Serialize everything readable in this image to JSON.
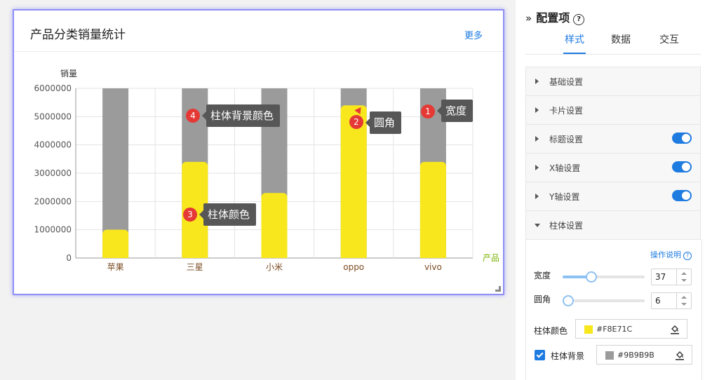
{
  "card": {
    "title": "产品分类销量统计",
    "more": "更多"
  },
  "chart_data": {
    "type": "bar",
    "ylabel": "销量",
    "xlabel": "产品",
    "categories": [
      "苹果",
      "三星",
      "小米",
      "oppo",
      "vivo"
    ],
    "values": [
      1000000,
      3400000,
      2300000,
      5400000,
      3400000
    ],
    "background_value": 6000000,
    "ylim": [
      0,
      6000000
    ],
    "yticks": [
      "0",
      "1000000",
      "2000000",
      "3000000",
      "4000000",
      "5000000",
      "6000000"
    ],
    "bar_color": "#F8E71C",
    "bar_background_color": "#9B9B9B",
    "grid": true
  },
  "callouts": [
    {
      "num": "1",
      "text": "宽度"
    },
    {
      "num": "2",
      "text": "圆角"
    },
    {
      "num": "3",
      "text": "柱体颜色"
    },
    {
      "num": "4",
      "text": "柱体背景颜色"
    }
  ],
  "panel": {
    "title": "配置项",
    "help": "?",
    "tabs": [
      "样式",
      "数据",
      "交互"
    ],
    "active_tab": "样式",
    "sections": [
      {
        "label": "基础设置",
        "toggle": false
      },
      {
        "label": "卡片设置",
        "toggle": false
      },
      {
        "label": "标题设置",
        "toggle": true
      },
      {
        "label": "X轴设置",
        "toggle": true
      },
      {
        "label": "Y轴设置",
        "toggle": true
      },
      {
        "label": "柱体设置",
        "toggle": false
      }
    ],
    "pillar": {
      "op_help": "操作说明",
      "width_label": "宽度",
      "width_value": "37",
      "width_slider": 0.35,
      "radius_label": "圆角",
      "radius_value": "6",
      "radius_slider": 0.0,
      "color_label": "柱体颜色",
      "color_hex": "#F8E71C",
      "bg_label": "柱体背景",
      "bg_hex": "#9B9B9B",
      "bg_checked": true
    }
  }
}
